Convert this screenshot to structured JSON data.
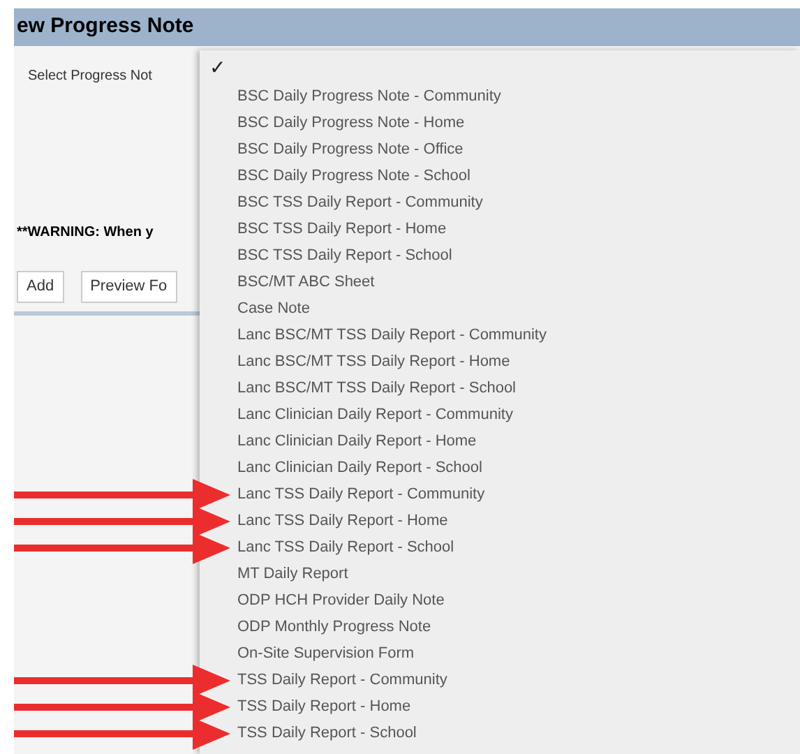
{
  "window": {
    "title": "ew Progress Note"
  },
  "field_label": "Select Progress Not",
  "warning": "**WARNING: When y",
  "buttons": [
    "Add",
    "Preview Fo"
  ],
  "dropdown": {
    "check": "✓",
    "items": [
      {
        "label": "BSC Daily Progress Note - Community",
        "marked": false
      },
      {
        "label": "BSC Daily Progress Note - Home",
        "marked": false
      },
      {
        "label": "BSC Daily Progress Note - Office",
        "marked": false
      },
      {
        "label": "BSC Daily Progress Note - School",
        "marked": false
      },
      {
        "label": "BSC TSS Daily Report - Community",
        "marked": false
      },
      {
        "label": "BSC TSS Daily Report - Home",
        "marked": false
      },
      {
        "label": "BSC TSS Daily Report - School",
        "marked": false
      },
      {
        "label": "BSC/MT ABC Sheet",
        "marked": false
      },
      {
        "label": "Case Note",
        "marked": false
      },
      {
        "label": "Lanc BSC/MT TSS Daily Report - Community",
        "marked": false
      },
      {
        "label": "Lanc BSC/MT TSS Daily Report - Home",
        "marked": false
      },
      {
        "label": "Lanc BSC/MT TSS Daily Report - School",
        "marked": false
      },
      {
        "label": "Lanc Clinician Daily Report - Community",
        "marked": false
      },
      {
        "label": "Lanc Clinician Daily Report - Home",
        "marked": false
      },
      {
        "label": "Lanc Clinician Daily Report - School",
        "marked": false
      },
      {
        "label": "Lanc TSS Daily Report - Community",
        "marked": true
      },
      {
        "label": "Lanc TSS Daily Report - Home",
        "marked": true
      },
      {
        "label": "Lanc TSS Daily Report - School",
        "marked": true
      },
      {
        "label": "MT Daily Report",
        "marked": false
      },
      {
        "label": "ODP HCH Provider Daily Note",
        "marked": false
      },
      {
        "label": "ODP Monthly Progress Note",
        "marked": false
      },
      {
        "label": "On-Site Supervision Form",
        "marked": false
      },
      {
        "label": "TSS Daily Report - Community",
        "marked": true
      },
      {
        "label": "TSS Daily Report - Home",
        "marked": true
      },
      {
        "label": "TSS Daily Report - School",
        "marked": true
      }
    ]
  }
}
